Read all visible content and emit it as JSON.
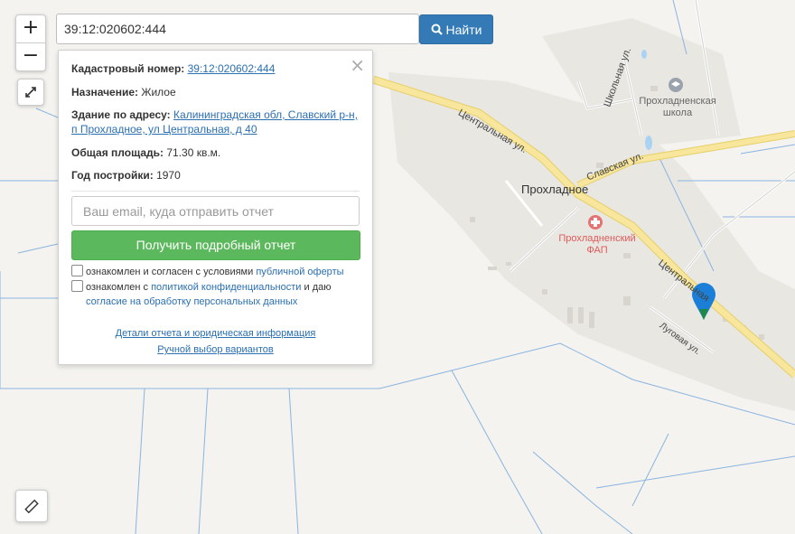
{
  "search": {
    "value": "39:12:020602:444",
    "button_label": "Найти"
  },
  "zoom": {
    "in": "+",
    "out": "−"
  },
  "popup": {
    "cadastral_label": "Кадастровый номер:",
    "cadastral_value": "39:12:020602:444",
    "purpose_label": "Назначение:",
    "purpose_value": "Жилое",
    "address_label": "Здание по адресу:",
    "address_line1": "Калининградская обл, Славский р-н,",
    "address_line2": "п Прохладное, ул Центральная, д 40",
    "area_label": "Общая площадь:",
    "area_value": "71.30 кв.м.",
    "year_label": "Год постройки:",
    "year_value": "1970",
    "email_placeholder": "Ваш email, куда отправить отчет",
    "report_button": "Получить подробный отчет",
    "consent1_text": "ознакомлен и согласен с условиями",
    "consent1_link": "публичной оферты",
    "consent2_text": "ознакомлен с",
    "consent2_link": "политикой конфиденциальности",
    "consent2_and": "и даю",
    "consent2_link2": "согласие на обработку персональных данных",
    "details_link": "Детали отчета и юридическая информация",
    "manual_link": "Ручной выбор вариантов"
  },
  "map": {
    "labels": {
      "settlement": "Прохладное",
      "school": "Прохладненская школа",
      "medic": "Прохладненский ФАП",
      "street_central_1": "Центральная ул.",
      "street_central_2": "Центральная",
      "street_school": "Школьная ул.",
      "street_slavsk": "Славская ул.",
      "street_lugovaya": "Луговая ул."
    },
    "colors": {
      "road_main": "#f7e69b",
      "road_outline": "#e6cf6a",
      "water_line": "#8ab4e0",
      "settlement_area": "#e9e7e2",
      "marker": "#1b7fd8",
      "report_button": "#5cb85c",
      "search_button": "#337ab7"
    }
  }
}
